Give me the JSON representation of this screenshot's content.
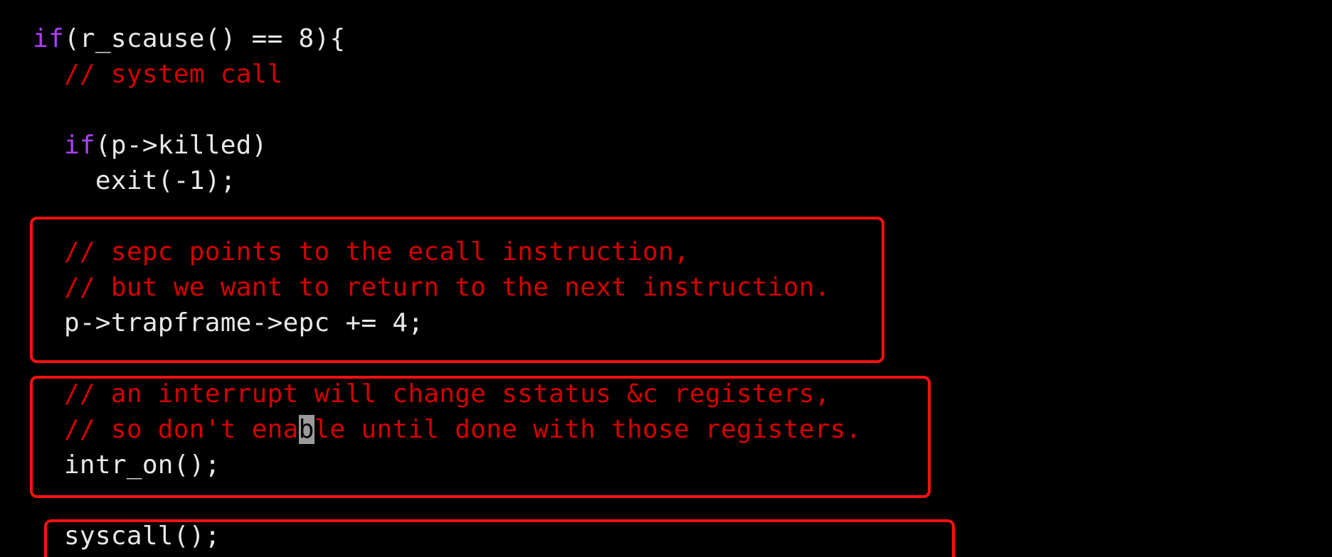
{
  "code": {
    "lines": [
      {
        "kw": "if",
        "text": "(r_scause() == 8){"
      },
      {
        "indent": "  ",
        "comment": "// system call"
      },
      {
        "text": ""
      },
      {
        "indent": "  ",
        "kw": "if",
        "text": "(p->killed)"
      },
      {
        "indent": "    ",
        "text": "exit(-1);"
      },
      {
        "text": ""
      },
      {
        "indent": "  ",
        "comment": "// sepc points to the ecall instruction,"
      },
      {
        "indent": "  ",
        "comment": "// but we want to return to the next instruction."
      },
      {
        "indent": "  ",
        "text": "p->trapframe->epc += 4;"
      },
      {
        "text": ""
      },
      {
        "indent": "  ",
        "comment": "// an interrupt will change sstatus &c registers,"
      },
      {
        "indent": "  ",
        "comment_before_cursor": "// so don't ena",
        "cursor_char": "b",
        "comment_after_cursor": "le until done with those registers."
      },
      {
        "indent": "  ",
        "text": "intr_on();"
      },
      {
        "text": ""
      },
      {
        "indent": "  ",
        "text": "syscall();"
      }
    ]
  },
  "colors": {
    "background": "#000000",
    "keyword": "#b040ff",
    "comment": "#d40000",
    "plain": "#e8e8e8",
    "highlight_box": "#ff1010",
    "cursor": "#9a9a9a"
  }
}
